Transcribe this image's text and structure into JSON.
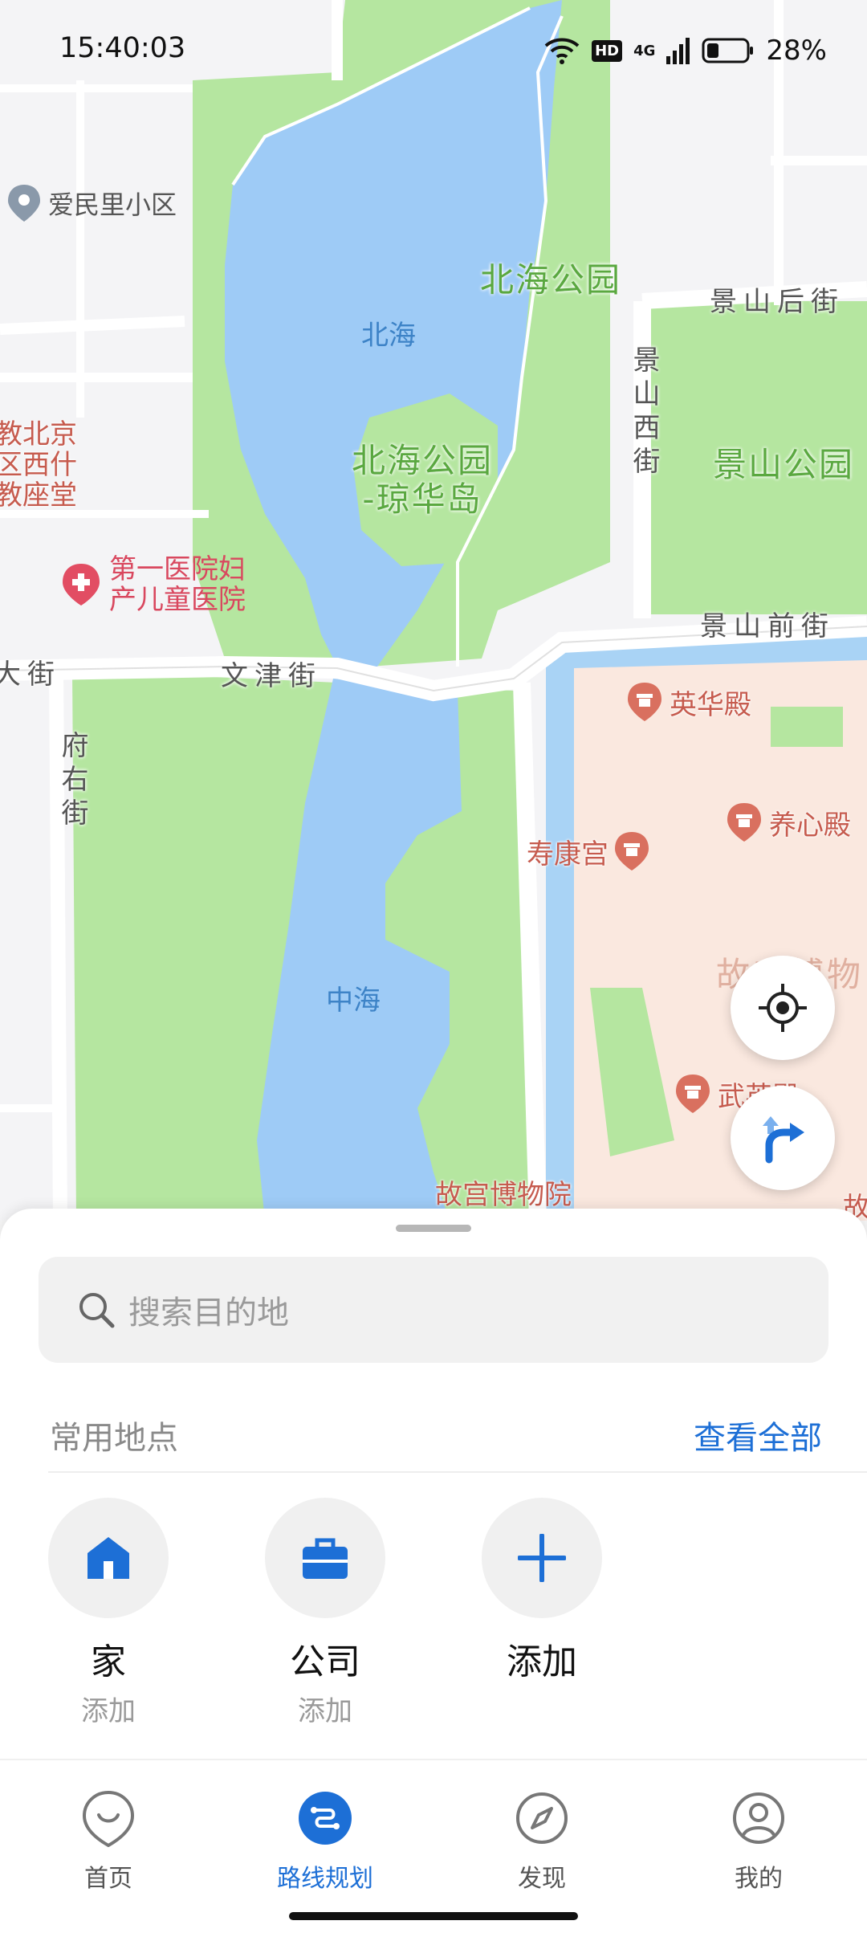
{
  "status_bar": {
    "time": "15:40:03",
    "hd_badge": "HD",
    "network": "4G",
    "battery": "28%"
  },
  "map": {
    "labels": {
      "beihai_park": "北海公园",
      "beihai": "北海",
      "qionghua": "北海公园\n-琼华岛",
      "jingshan_park": "景山公园",
      "zhonghai": "中海",
      "jingshan_hou": "景山后街",
      "jingshan_xi": "景山西街",
      "jingshan_qian": "景山前街",
      "wenjin": "文津街",
      "fuyou": "府右街",
      "dajie": "大街",
      "aiminli": "爱民里小区",
      "hospital": "第一医院妇\n产儿童医院",
      "church": "教北京\n区西什\n教座堂",
      "yinghua": "英华殿",
      "yangxin": "养心殿",
      "shoukang": "寿康宫",
      "gugong_top": "故宫博物",
      "wuying": "武英殿",
      "gugong_bottom": "故宫博物院",
      "gu_edge": "故"
    }
  },
  "bottom_sheet": {
    "search_placeholder": "搜索目的地",
    "frequent_title": "常用地点",
    "view_all": "查看全部",
    "places": [
      {
        "name": "家",
        "sub": "添加",
        "icon": "home-icon"
      },
      {
        "name": "公司",
        "sub": "添加",
        "icon": "briefcase-icon"
      },
      {
        "name": "添加",
        "sub": "",
        "icon": "plus-icon"
      }
    ]
  },
  "tabs": [
    {
      "label": "首页",
      "icon": "home-smile-icon",
      "active": false
    },
    {
      "label": "路线规划",
      "icon": "route-icon",
      "active": true
    },
    {
      "label": "发现",
      "icon": "compass-icon",
      "active": false
    },
    {
      "label": "我的",
      "icon": "profile-icon",
      "active": false
    }
  ],
  "colors": {
    "accent": "#1d6fd6",
    "water": "#9ecbf6",
    "park": "#b5e6a0",
    "palace": "#fae8df"
  }
}
